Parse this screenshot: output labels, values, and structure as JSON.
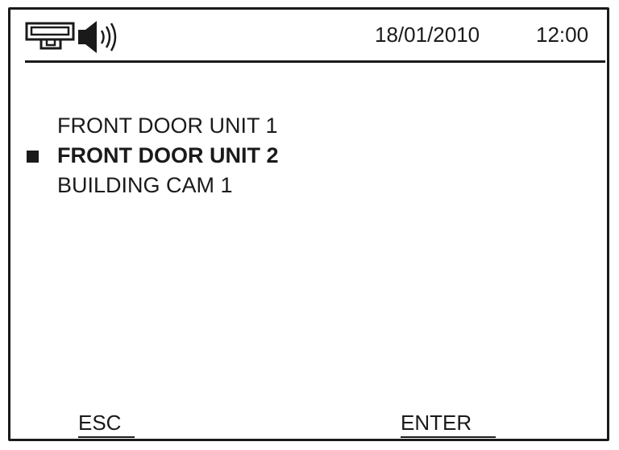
{
  "status_bar": {
    "icons": [
      "intercom-unit-icon",
      "speaker-volume-icon"
    ],
    "date": "18/01/2010",
    "time": "12:00"
  },
  "menu": {
    "items": [
      {
        "label": "FRONT DOOR UNIT 1",
        "selected": false
      },
      {
        "label": "FRONT DOOR UNIT 2",
        "selected": true
      },
      {
        "label": "BUILDING CAM 1",
        "selected": false
      }
    ]
  },
  "softkeys": {
    "esc_label": "ESC",
    "enter_label": "ENTER"
  },
  "colors": {
    "foreground": "#1a1a1a",
    "background": "#ffffff"
  }
}
